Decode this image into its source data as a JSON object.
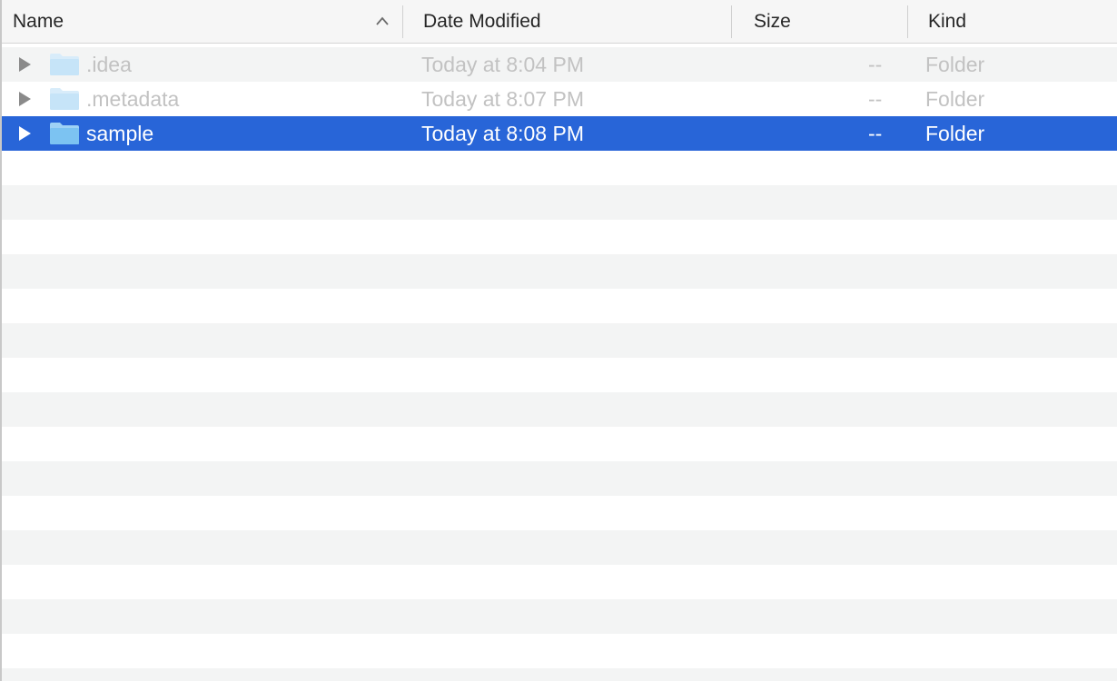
{
  "header": {
    "name_label": "Name",
    "date_label": "Date Modified",
    "size_label": "Size",
    "kind_label": "Kind"
  },
  "rows": [
    {
      "name": ".idea",
      "date": "Today at 8:04 PM",
      "size": "--",
      "kind": "Folder",
      "selected": false
    },
    {
      "name": ".metadata",
      "date": "Today at 8:07 PM",
      "size": "--",
      "kind": "Folder",
      "selected": false
    },
    {
      "name": "sample",
      "date": "Today at 8:08 PM",
      "size": "--",
      "kind": "Folder",
      "selected": true
    }
  ],
  "colors": {
    "selection": "#2865d8",
    "folder": "#7cc3f2",
    "stripe": "#f3f4f4"
  },
  "icons": {
    "sort": "chevron-up-icon",
    "disclosure": "disclosure-triangle-icon",
    "folder": "folder-icon"
  }
}
